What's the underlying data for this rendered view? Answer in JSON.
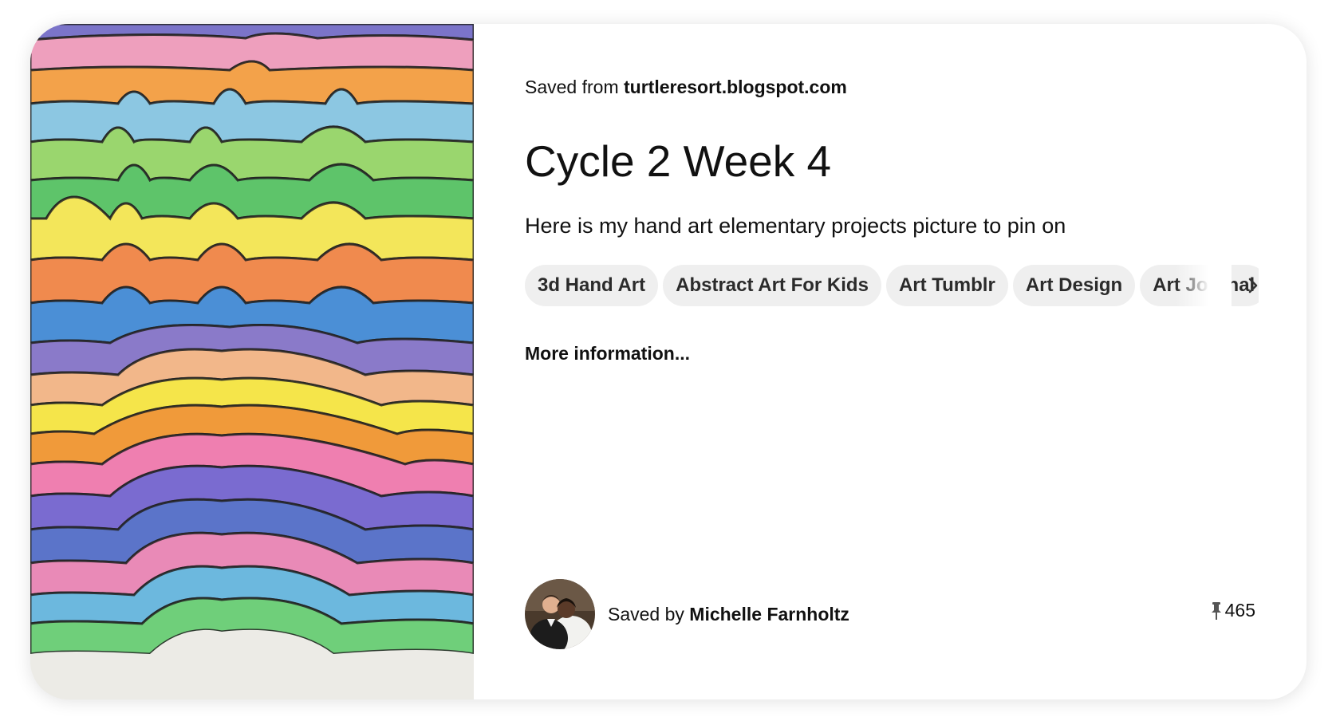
{
  "pin": {
    "saved_from_prefix": "Saved from",
    "saved_from_domain": "turtleresort.blogspot.com",
    "title": "Cycle 2 Week 4",
    "description": "Here is my hand art elementary projects picture to pin on",
    "tags": [
      "3d Hand Art",
      "Abstract Art For Kids",
      "Art Tumblr",
      "Art Design",
      "Art Journal"
    ],
    "more_info_label": "More information...",
    "saved_by_prefix": "Saved by",
    "saved_by_user": "Michelle Farnholtz",
    "save_count": "465"
  },
  "icons": {
    "tags_next": "chevron-right-icon",
    "save_count": "pushpin-icon"
  },
  "colors": {
    "tag_background": "#efefef",
    "text": "#111111"
  }
}
